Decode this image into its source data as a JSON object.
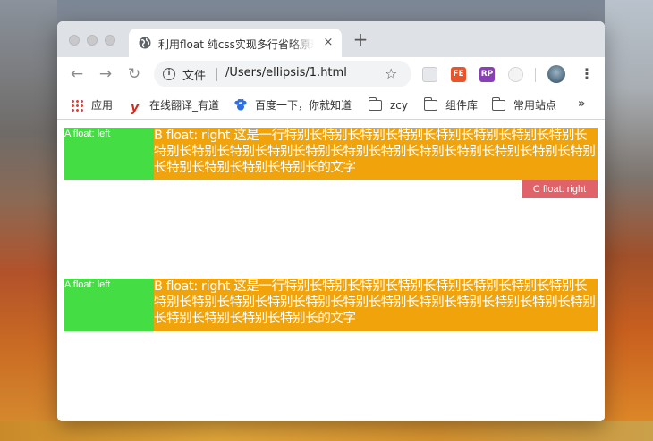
{
  "browser": {
    "tab": {
      "title": "利用float 纯css实现多行省略原理",
      "close": "×"
    },
    "new_tab": "+",
    "nav": {
      "back": "←",
      "forward": "→",
      "reload": "↻"
    },
    "omnibox": {
      "scheme_label": "文件",
      "url": "/Users/ellipsis/1.html",
      "star": "☆"
    },
    "extensions": [
      {
        "icon": "capture-icon",
        "label": ""
      },
      {
        "icon": "fe-icon",
        "label": "FE"
      },
      {
        "icon": "rp-icon",
        "label": "RP"
      },
      {
        "icon": "dropper-icon",
        "label": ""
      }
    ],
    "menu": "⋮",
    "bookmarks": [
      {
        "icon": "apps-icon",
        "label": "应用"
      },
      {
        "icon": "youdao-icon",
        "label": "在线翻译_有道"
      },
      {
        "icon": "baidu-icon",
        "label": "百度一下，你就知道"
      },
      {
        "icon": "folder-icon",
        "label": "zcy"
      },
      {
        "icon": "folder-icon",
        "label": "组件库"
      },
      {
        "icon": "folder-icon",
        "label": "常用站点"
      }
    ],
    "bookmarks_more": "»"
  },
  "page": {
    "demo1": {
      "a": "A float: left",
      "b": "B float: right 这是一行特别长特别长特别长特别长特别长特别长特别长特别长特别长特别长特别长特别长特别长特别长特别长特别长特别长特别长特别长特别长特别长特别长特别长特别长的文字",
      "c": "C float: right"
    },
    "demo2": {
      "a": "A float: left",
      "b": "B float: right 这是一行特别长特别长特别长特别长特别长特别长特别长特别长特别长特别长特别长特别长特别长特别长特别长特别长特别长特别长特别长特别长特别长特别长特别长特别长的文字"
    }
  },
  "colors": {
    "box_a": "#44dd44",
    "box_b": "#f0a30a",
    "box_c": "#e0636a"
  }
}
